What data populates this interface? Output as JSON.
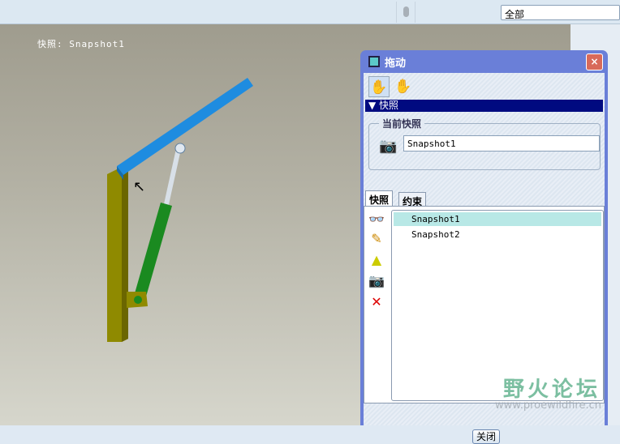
{
  "toolbar": {
    "filter_value": "全部"
  },
  "viewport": {
    "snapshot_label": "快照: Snapshot1"
  },
  "dialog": {
    "title": "拖动",
    "close_icon": "×",
    "section_label": "快照",
    "current_group_label": "当前快照",
    "current_snapshot": "Snapshot1",
    "tabs": [
      {
        "label": "快照",
        "active": true
      },
      {
        "label": "约束",
        "active": false
      }
    ],
    "side_icons": [
      "glasses-icon",
      "pencil-icon",
      "warning-add-icon",
      "camera-icon",
      "delete-icon"
    ],
    "snapshots": [
      {
        "name": "Snapshot1",
        "selected": true
      },
      {
        "name": "Snapshot2",
        "selected": false
      }
    ],
    "close_button": "关闭"
  },
  "watermark": {
    "title": "野火论坛",
    "url": "www.proewildfire.cn"
  }
}
